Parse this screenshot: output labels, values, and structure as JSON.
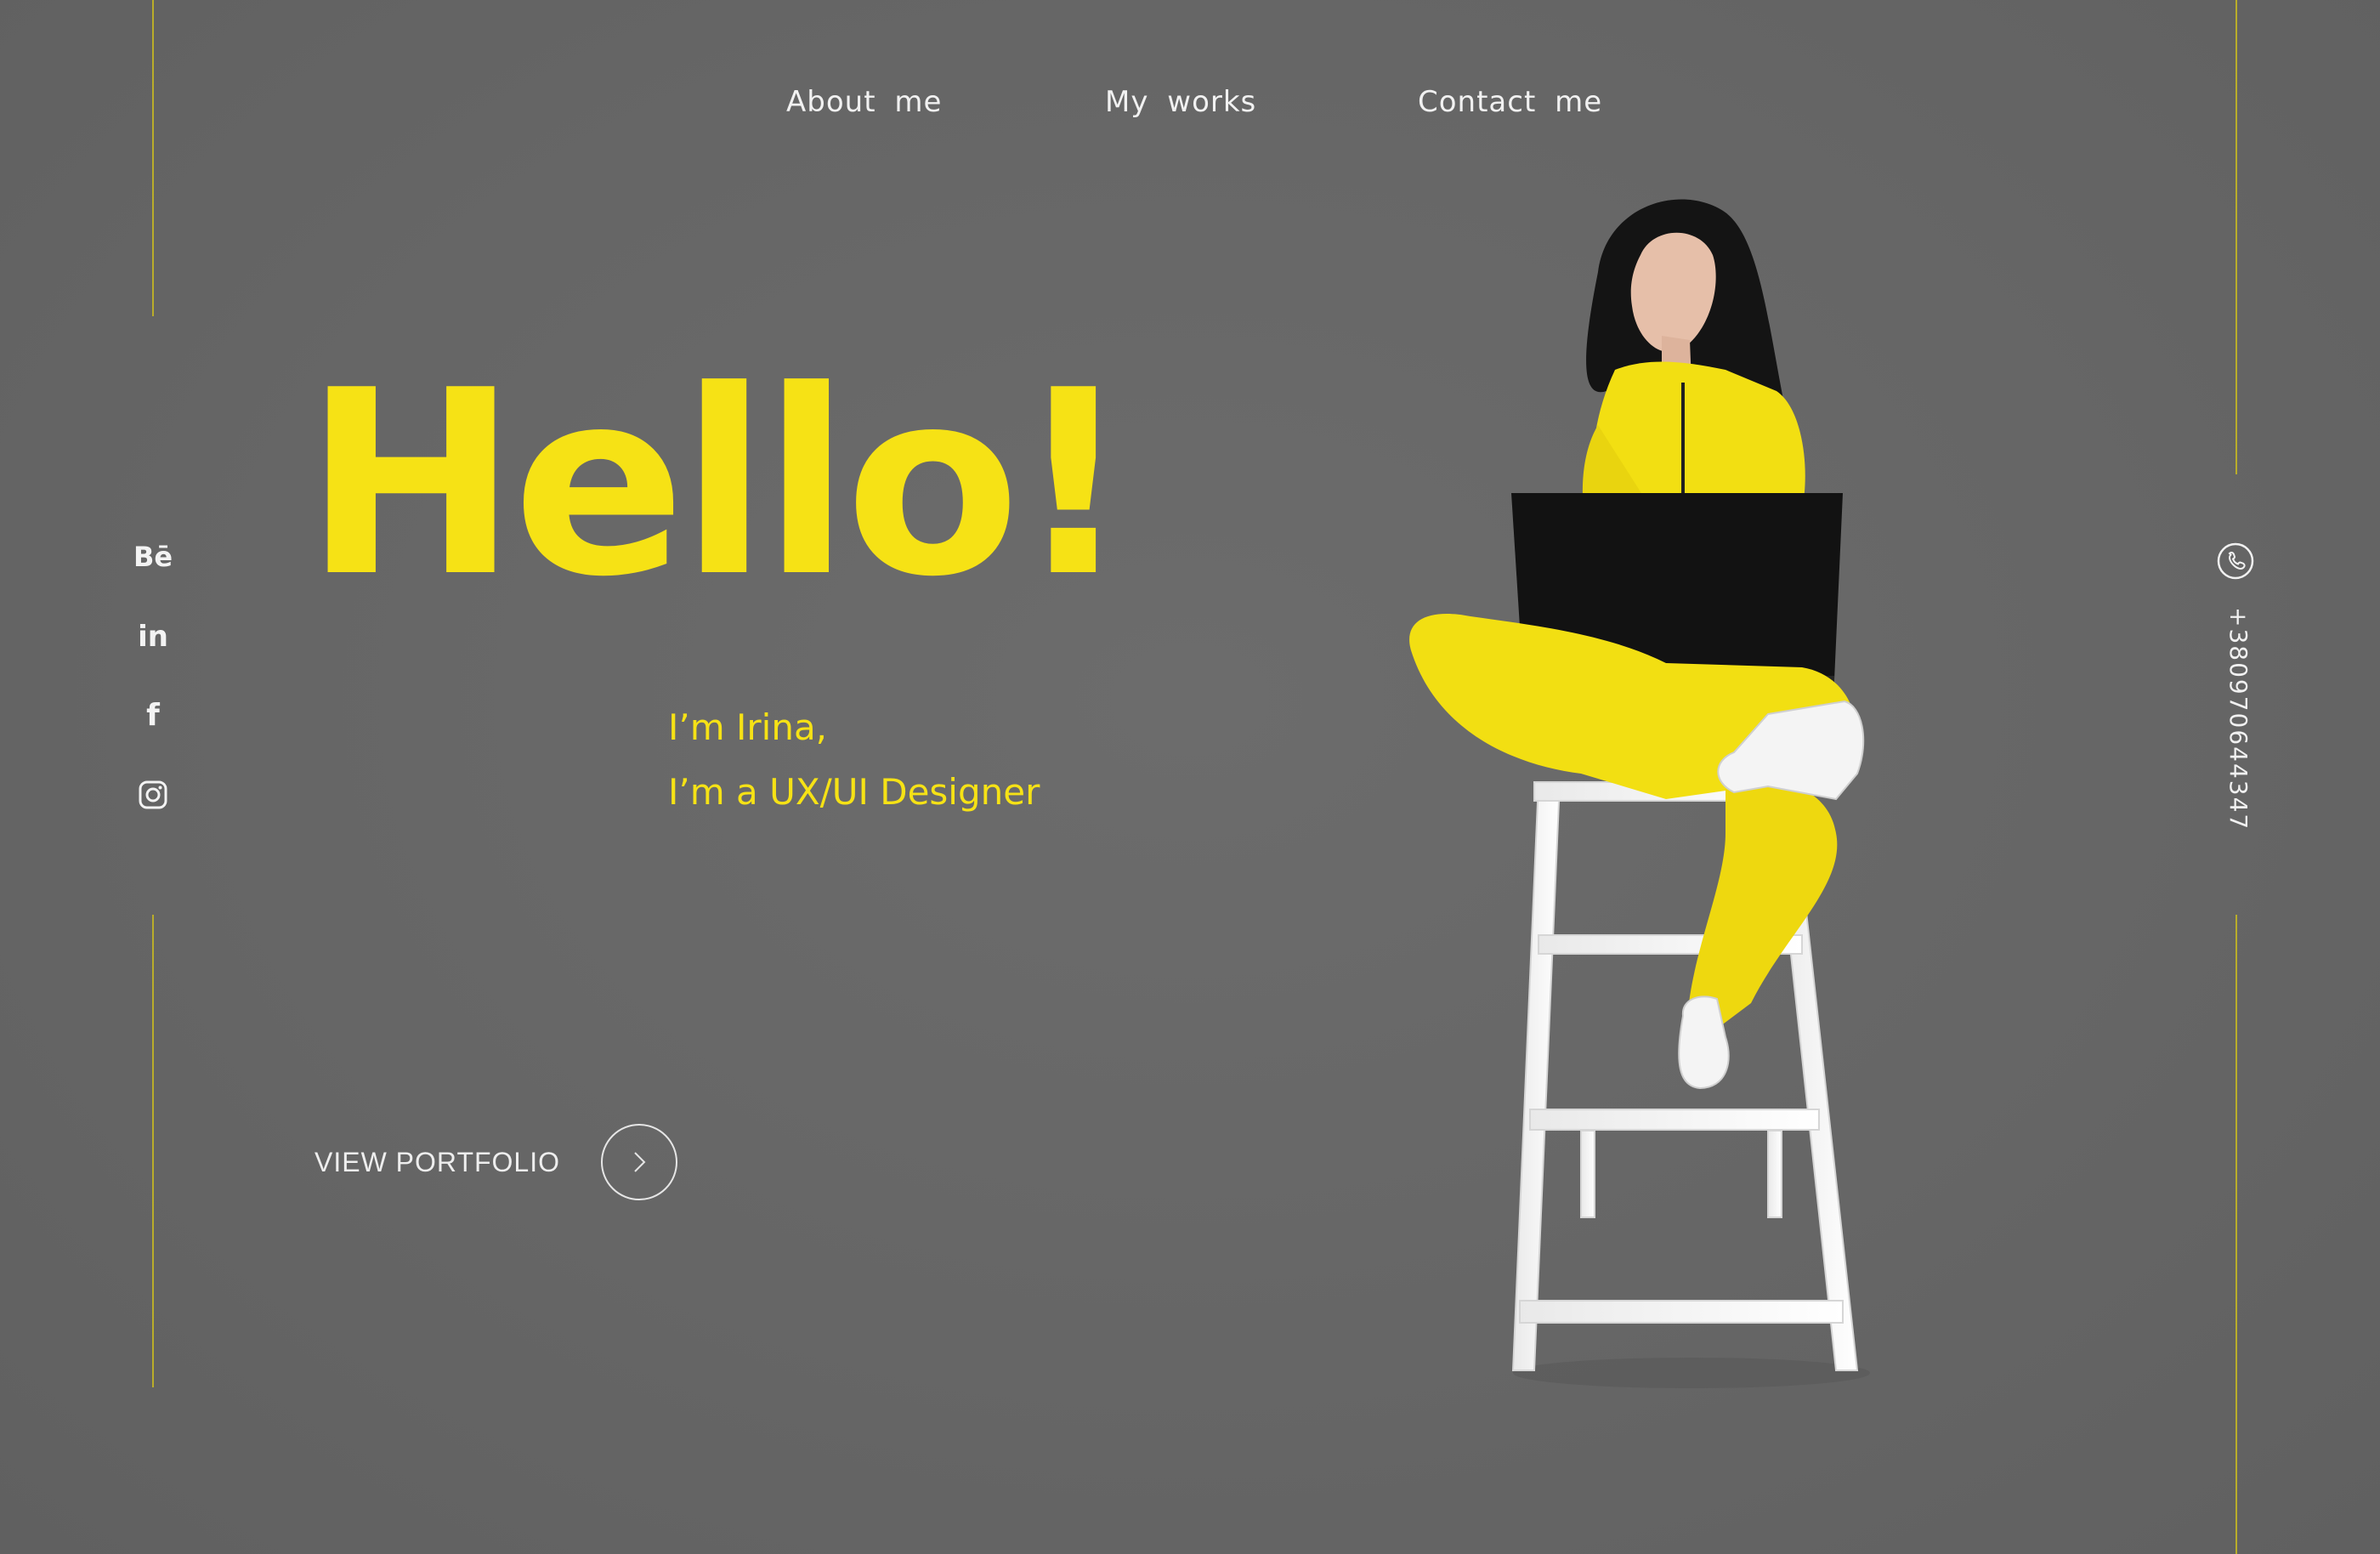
{
  "nav": {
    "items": [
      {
        "label": "About  me"
      },
      {
        "label": "My  works"
      },
      {
        "label": "Contact  me"
      }
    ]
  },
  "social": {
    "behance": "Bē",
    "linkedin": "in",
    "facebook": "f",
    "instagram_icon": "instagram-icon"
  },
  "hero": {
    "heading": "Hello!",
    "line1": "I’m Irina,",
    "line2": "I’m a UX/UI Designer"
  },
  "cta": {
    "label": "VIEW PORTFOLIO",
    "icon": "chevron-right-icon"
  },
  "contact": {
    "phone": "+380970644347",
    "icon": "phone-icon"
  },
  "colors": {
    "background": "#666666",
    "accent": "#f6e215",
    "text": "#f1f1f1",
    "rail": "#b9ad2a"
  }
}
